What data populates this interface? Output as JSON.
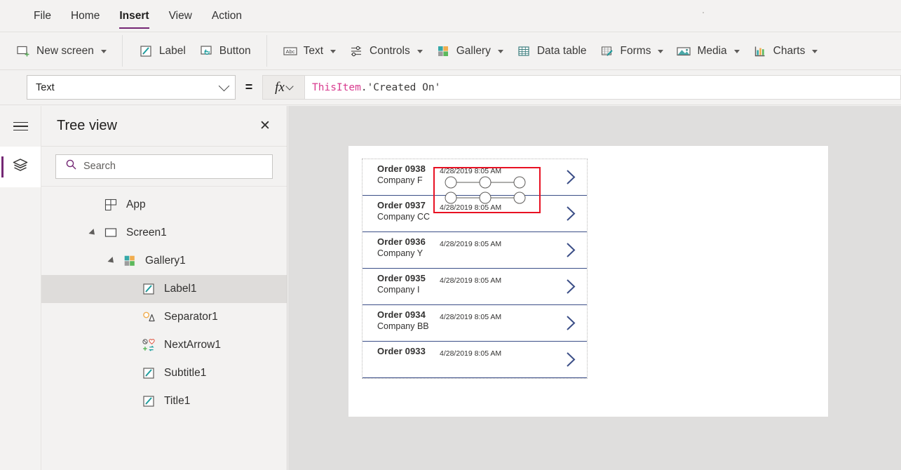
{
  "menubar": {
    "items": [
      {
        "label": "File",
        "active": false
      },
      {
        "label": "Home",
        "active": false
      },
      {
        "label": "Insert",
        "active": true
      },
      {
        "label": "View",
        "active": false
      },
      {
        "label": "Action",
        "active": false
      }
    ]
  },
  "ribbon": {
    "groups": [
      {
        "items": [
          {
            "label": "New screen",
            "icon": "new-screen-icon",
            "caret": true
          }
        ]
      },
      {
        "items": [
          {
            "label": "Label",
            "icon": "label-icon",
            "caret": false
          },
          {
            "label": "Button",
            "icon": "button-icon",
            "caret": false
          }
        ]
      },
      {
        "items": [
          {
            "label": "Text",
            "icon": "text-abc-icon",
            "caret": true
          },
          {
            "label": "Controls",
            "icon": "controls-sliders-icon",
            "caret": true
          },
          {
            "label": "Gallery",
            "icon": "gallery-icon",
            "caret": true
          },
          {
            "label": "Data table",
            "icon": "data-table-icon",
            "caret": false
          },
          {
            "label": "Forms",
            "icon": "forms-icon",
            "caret": true
          },
          {
            "label": "Media",
            "icon": "media-image-icon",
            "caret": true
          },
          {
            "label": "Charts",
            "icon": "charts-bar-icon",
            "caret": true
          }
        ]
      }
    ]
  },
  "formula_bar": {
    "property_value": "Text",
    "equals": "=",
    "fx_label": "fx",
    "formula": {
      "identifier": "ThisItem",
      "punct": ".",
      "string": "'Created On'"
    }
  },
  "left_rail": {
    "hamburger": "hamburger-icon",
    "tree_view_button": "tree-view-layers-icon"
  },
  "tree_view": {
    "title": "Tree view",
    "close_label": "✕",
    "search_placeholder": "Search",
    "search_value": "",
    "nodes": [
      {
        "label": "App",
        "icon": "app-icon",
        "indent": 0,
        "expander": "none",
        "selected": false
      },
      {
        "label": "Screen1",
        "icon": "screen-icon",
        "indent": 0,
        "expander": "expanded",
        "selected": false
      },
      {
        "label": "Gallery1",
        "icon": "gallery-icon",
        "indent": 1,
        "expander": "expanded",
        "selected": false
      },
      {
        "label": "Label1",
        "icon": "label-icon",
        "indent": 2,
        "expander": "none",
        "selected": true
      },
      {
        "label": "Separator1",
        "icon": "separator-icon",
        "indent": 2,
        "expander": "none",
        "selected": false
      },
      {
        "label": "NextArrow1",
        "icon": "nextarrow-icon",
        "indent": 2,
        "expander": "none",
        "selected": false
      },
      {
        "label": "Subtitle1",
        "icon": "label-icon",
        "indent": 2,
        "expander": "none",
        "selected": false
      },
      {
        "label": "Title1",
        "icon": "label-icon",
        "indent": 2,
        "expander": "none",
        "selected": false
      }
    ]
  },
  "canvas": {
    "gallery_items": [
      {
        "title": "Order 0938",
        "subtitle": "Company F",
        "date": "4/28/2019 8:05 AM",
        "selected_child": true
      },
      {
        "title": "Order 0937",
        "subtitle": "Company CC",
        "date": "4/28/2019 8:05 AM",
        "selected_child": false
      },
      {
        "title": "Order 0936",
        "subtitle": "Company Y",
        "date": "4/28/2019 8:05 AM",
        "selected_child": false
      },
      {
        "title": "Order 0935",
        "subtitle": "Company I",
        "date": "4/28/2019 8:05 AM",
        "selected_child": false
      },
      {
        "title": "Order 0934",
        "subtitle": "Company BB",
        "date": "4/28/2019 8:05 AM",
        "selected_child": false
      },
      {
        "title": "Order 0933",
        "subtitle": "",
        "date": "4/28/2019 8:05 AM",
        "selected_child": false
      }
    ],
    "selection_color": "#e81123",
    "chevron_color": "#3b4e87"
  },
  "colors": {
    "accent": "#742774",
    "selected_row": "#dedcda",
    "canvas_bg": "#dfdedd",
    "chrome_bg": "#f3f2f1",
    "formula_identifier": "#d83b8f"
  }
}
